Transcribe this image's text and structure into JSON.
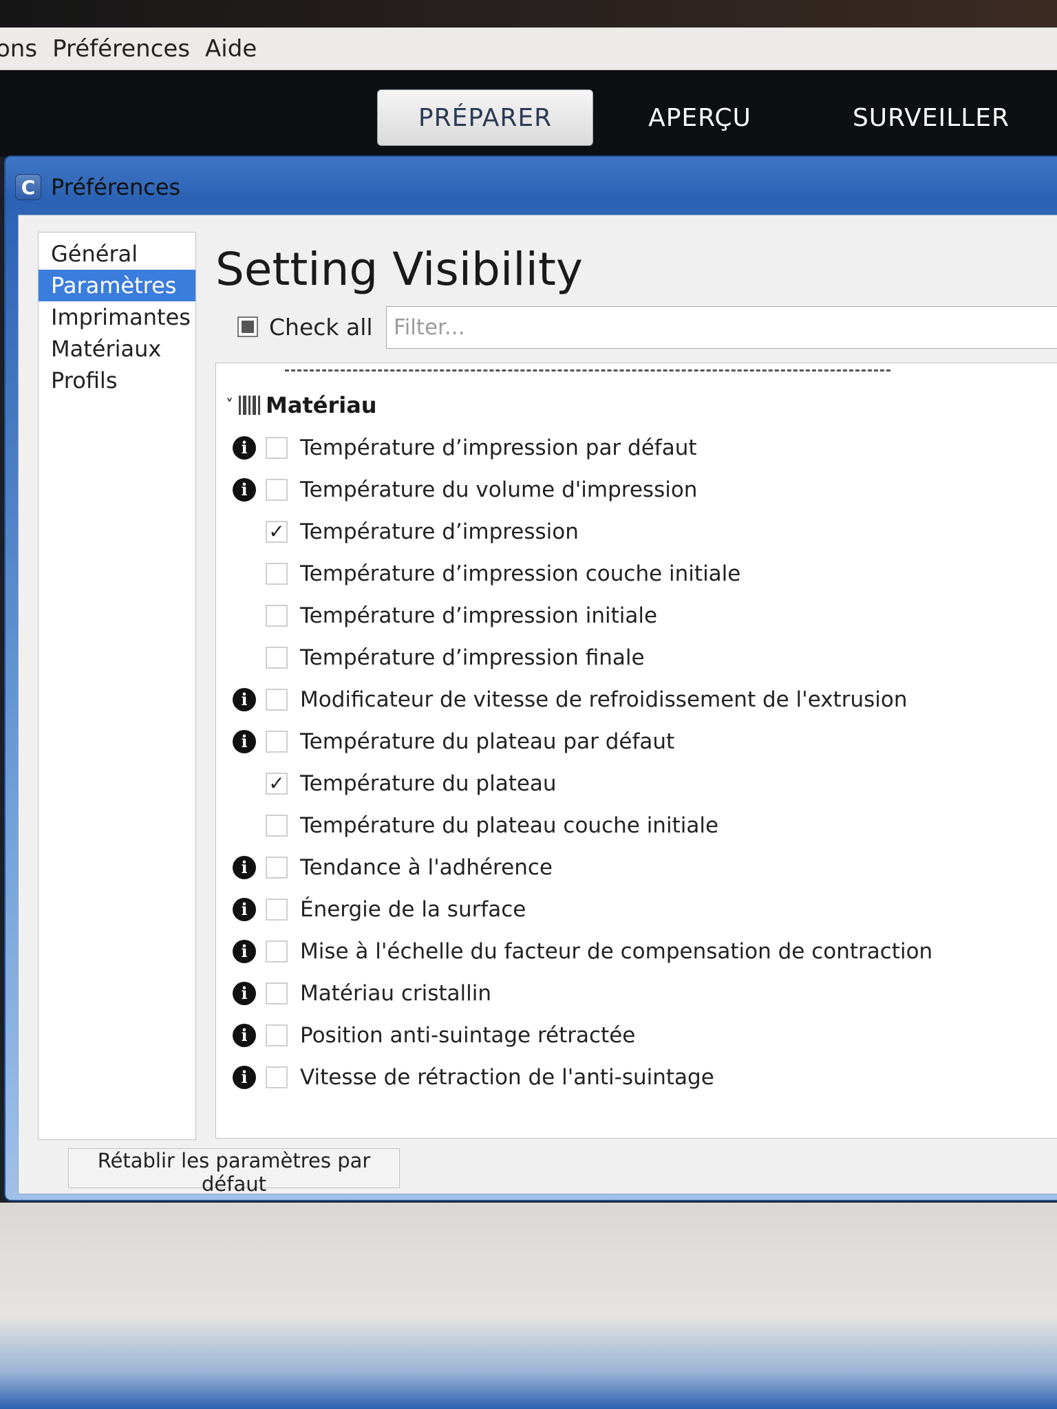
{
  "menubar": {
    "items": [
      "ons",
      "Préférences",
      "Aide"
    ]
  },
  "stages": [
    {
      "label": "PRÉPARER",
      "active": true
    },
    {
      "label": "APERÇU",
      "active": false
    },
    {
      "label": "SURVEILLER",
      "active": false
    }
  ],
  "window": {
    "title": "Préférences",
    "icon": "C"
  },
  "nav": {
    "items": [
      "Général",
      "Paramètres",
      "Imprimantes",
      "Matériaux",
      "Profils"
    ],
    "selected": "Paramètres"
  },
  "page": {
    "title": "Setting Visibility",
    "check_all_label": "Check all",
    "filter_placeholder": "Filter..."
  },
  "category": {
    "name": "Matériau",
    "icon": "material-barcode-icon",
    "expanded": true
  },
  "settings": [
    {
      "label": "Température d’impression par défaut",
      "info": true,
      "checked": false
    },
    {
      "label": "Température du volume d'impression",
      "info": true,
      "checked": false
    },
    {
      "label": "Température d’impression",
      "info": false,
      "checked": true
    },
    {
      "label": "Température d’impression couche initiale",
      "info": false,
      "checked": false
    },
    {
      "label": "Température d’impression initiale",
      "info": false,
      "checked": false
    },
    {
      "label": "Température d’impression finale",
      "info": false,
      "checked": false
    },
    {
      "label": "Modificateur de vitesse de refroidissement de l'extrusion",
      "info": true,
      "checked": false
    },
    {
      "label": "Température du plateau par défaut",
      "info": true,
      "checked": false
    },
    {
      "label": "Température du plateau",
      "info": false,
      "checked": true
    },
    {
      "label": "Température du plateau couche initiale",
      "info": false,
      "checked": false
    },
    {
      "label": "Tendance à l'adhérence",
      "info": true,
      "checked": false
    },
    {
      "label": "Énergie de la surface",
      "info": true,
      "checked": false
    },
    {
      "label": "Mise à l'échelle du facteur de compensation de contraction",
      "info": true,
      "checked": false
    },
    {
      "label": "Matériau cristallin",
      "info": true,
      "checked": false
    },
    {
      "label": "Position anti-suintage rétractée",
      "info": true,
      "checked": false
    },
    {
      "label": "Vitesse de rétraction de l'anti-suintage",
      "info": true,
      "checked": false
    }
  ],
  "symbols": {
    "info": "i",
    "check": "✓",
    "chevron": "˅"
  },
  "footer": {
    "reset_label": "Rétablir les paramètres par défaut"
  },
  "colors": {
    "accent": "#3b7ddd",
    "titlebar": "#2c62b4"
  }
}
